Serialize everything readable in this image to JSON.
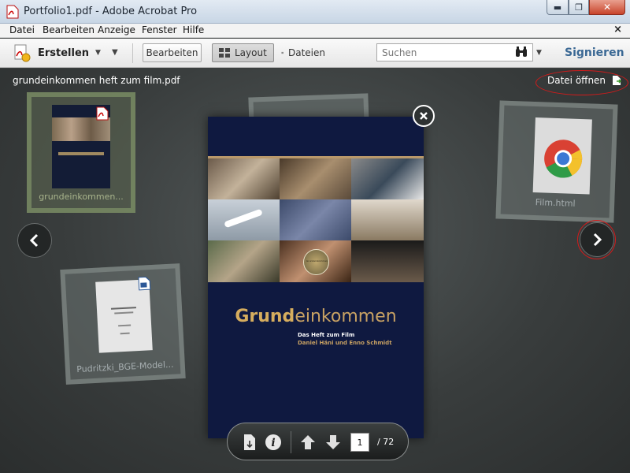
{
  "window": {
    "title": "Portfolio1.pdf - Adobe Acrobat Pro",
    "minimize_glyph": "▬",
    "maximize_glyph": "❐",
    "close_glyph": "✕",
    "app_icon": "pdf-file-icon"
  },
  "menubar": {
    "items": [
      "Datei",
      "Bearbeiten",
      "Anzeige",
      "Fenster",
      "Hilfe"
    ],
    "close_glyph": "×"
  },
  "toolbar": {
    "create_label": "Erstellen",
    "edit_label": "Bearbeiten",
    "layout_label": "Layout",
    "files_label": "Dateien",
    "search_placeholder": "Suchen",
    "sign_label": "Signieren"
  },
  "work": {
    "filename": "grundeinkommen heft zum film.pdf",
    "open_file_label": "Datei öffnen",
    "cards": {
      "left_caption": "grundeinkommen...",
      "right_caption": "Film.html",
      "bottom_left_caption": "Pudritzki_BGE-Model..."
    },
    "cover": {
      "title_bold": "Grund",
      "title_rest": "einkommen",
      "subtitle": "Das Heft zum Film",
      "authors": "Daniel Häni und Enno Schmidt",
      "badge_text": "Grundeinkommen"
    },
    "pager": {
      "current_page": "1",
      "total": "/ 72"
    }
  },
  "colors": {
    "highlight": "#d21b1b",
    "sign": "#3a6894",
    "cover_bg": "#0f1940",
    "cover_gold": "#c9a263"
  }
}
